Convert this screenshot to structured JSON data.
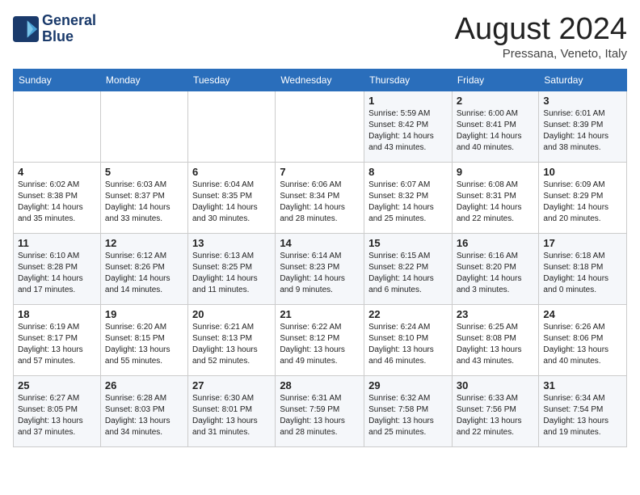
{
  "logo": {
    "line1": "General",
    "line2": "Blue"
  },
  "title": "August 2024",
  "location": "Pressana, Veneto, Italy",
  "weekdays": [
    "Sunday",
    "Monday",
    "Tuesday",
    "Wednesday",
    "Thursday",
    "Friday",
    "Saturday"
  ],
  "weeks": [
    [
      {
        "num": "",
        "info": ""
      },
      {
        "num": "",
        "info": ""
      },
      {
        "num": "",
        "info": ""
      },
      {
        "num": "",
        "info": ""
      },
      {
        "num": "1",
        "info": "Sunrise: 5:59 AM\nSunset: 8:42 PM\nDaylight: 14 hours\nand 43 minutes."
      },
      {
        "num": "2",
        "info": "Sunrise: 6:00 AM\nSunset: 8:41 PM\nDaylight: 14 hours\nand 40 minutes."
      },
      {
        "num": "3",
        "info": "Sunrise: 6:01 AM\nSunset: 8:39 PM\nDaylight: 14 hours\nand 38 minutes."
      }
    ],
    [
      {
        "num": "4",
        "info": "Sunrise: 6:02 AM\nSunset: 8:38 PM\nDaylight: 14 hours\nand 35 minutes."
      },
      {
        "num": "5",
        "info": "Sunrise: 6:03 AM\nSunset: 8:37 PM\nDaylight: 14 hours\nand 33 minutes."
      },
      {
        "num": "6",
        "info": "Sunrise: 6:04 AM\nSunset: 8:35 PM\nDaylight: 14 hours\nand 30 minutes."
      },
      {
        "num": "7",
        "info": "Sunrise: 6:06 AM\nSunset: 8:34 PM\nDaylight: 14 hours\nand 28 minutes."
      },
      {
        "num": "8",
        "info": "Sunrise: 6:07 AM\nSunset: 8:32 PM\nDaylight: 14 hours\nand 25 minutes."
      },
      {
        "num": "9",
        "info": "Sunrise: 6:08 AM\nSunset: 8:31 PM\nDaylight: 14 hours\nand 22 minutes."
      },
      {
        "num": "10",
        "info": "Sunrise: 6:09 AM\nSunset: 8:29 PM\nDaylight: 14 hours\nand 20 minutes."
      }
    ],
    [
      {
        "num": "11",
        "info": "Sunrise: 6:10 AM\nSunset: 8:28 PM\nDaylight: 14 hours\nand 17 minutes."
      },
      {
        "num": "12",
        "info": "Sunrise: 6:12 AM\nSunset: 8:26 PM\nDaylight: 14 hours\nand 14 minutes."
      },
      {
        "num": "13",
        "info": "Sunrise: 6:13 AM\nSunset: 8:25 PM\nDaylight: 14 hours\nand 11 minutes."
      },
      {
        "num": "14",
        "info": "Sunrise: 6:14 AM\nSunset: 8:23 PM\nDaylight: 14 hours\nand 9 minutes."
      },
      {
        "num": "15",
        "info": "Sunrise: 6:15 AM\nSunset: 8:22 PM\nDaylight: 14 hours\nand 6 minutes."
      },
      {
        "num": "16",
        "info": "Sunrise: 6:16 AM\nSunset: 8:20 PM\nDaylight: 14 hours\nand 3 minutes."
      },
      {
        "num": "17",
        "info": "Sunrise: 6:18 AM\nSunset: 8:18 PM\nDaylight: 14 hours\nand 0 minutes."
      }
    ],
    [
      {
        "num": "18",
        "info": "Sunrise: 6:19 AM\nSunset: 8:17 PM\nDaylight: 13 hours\nand 57 minutes."
      },
      {
        "num": "19",
        "info": "Sunrise: 6:20 AM\nSunset: 8:15 PM\nDaylight: 13 hours\nand 55 minutes."
      },
      {
        "num": "20",
        "info": "Sunrise: 6:21 AM\nSunset: 8:13 PM\nDaylight: 13 hours\nand 52 minutes."
      },
      {
        "num": "21",
        "info": "Sunrise: 6:22 AM\nSunset: 8:12 PM\nDaylight: 13 hours\nand 49 minutes."
      },
      {
        "num": "22",
        "info": "Sunrise: 6:24 AM\nSunset: 8:10 PM\nDaylight: 13 hours\nand 46 minutes."
      },
      {
        "num": "23",
        "info": "Sunrise: 6:25 AM\nSunset: 8:08 PM\nDaylight: 13 hours\nand 43 minutes."
      },
      {
        "num": "24",
        "info": "Sunrise: 6:26 AM\nSunset: 8:06 PM\nDaylight: 13 hours\nand 40 minutes."
      }
    ],
    [
      {
        "num": "25",
        "info": "Sunrise: 6:27 AM\nSunset: 8:05 PM\nDaylight: 13 hours\nand 37 minutes."
      },
      {
        "num": "26",
        "info": "Sunrise: 6:28 AM\nSunset: 8:03 PM\nDaylight: 13 hours\nand 34 minutes."
      },
      {
        "num": "27",
        "info": "Sunrise: 6:30 AM\nSunset: 8:01 PM\nDaylight: 13 hours\nand 31 minutes."
      },
      {
        "num": "28",
        "info": "Sunrise: 6:31 AM\nSunset: 7:59 PM\nDaylight: 13 hours\nand 28 minutes."
      },
      {
        "num": "29",
        "info": "Sunrise: 6:32 AM\nSunset: 7:58 PM\nDaylight: 13 hours\nand 25 minutes."
      },
      {
        "num": "30",
        "info": "Sunrise: 6:33 AM\nSunset: 7:56 PM\nDaylight: 13 hours\nand 22 minutes."
      },
      {
        "num": "31",
        "info": "Sunrise: 6:34 AM\nSunset: 7:54 PM\nDaylight: 13 hours\nand 19 minutes."
      }
    ]
  ]
}
